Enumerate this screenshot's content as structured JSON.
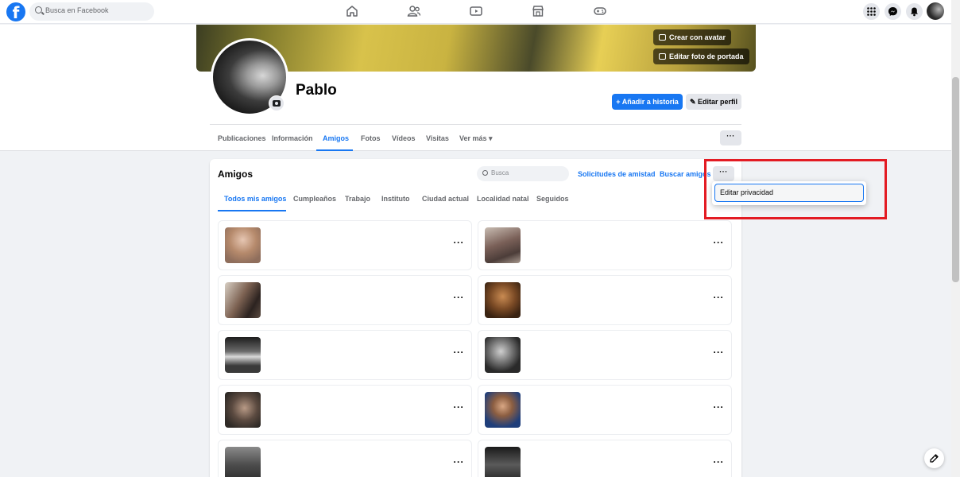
{
  "topbar": {
    "logo": "f",
    "search_placeholder": "Busca en Facebook",
    "nav_icons": [
      "home-icon",
      "friends-icon",
      "watch-icon",
      "marketplace-icon",
      "gaming-icon"
    ],
    "right_icons": [
      "menu-grid-icon",
      "messenger-icon",
      "bell-icon",
      "account-avatar"
    ]
  },
  "profile": {
    "name": "Pablo",
    "cover_buttons": {
      "avatar": "Crear con avatar",
      "cover": "Editar foto de portada"
    },
    "add_story": "Añadir a historia",
    "edit_profile": "Editar perfil",
    "tabs": [
      "Publicaciones",
      "Información",
      "Amigos",
      "Fotos",
      "Vídeos",
      "Visitas",
      "Ver más"
    ],
    "active_tab": "Amigos",
    "more_dots": "···"
  },
  "friends": {
    "title": "Amigos",
    "search_placeholder": "Busca",
    "requests_link": "Solicitudes de amistad",
    "find_link": "Buscar amigos",
    "more_dots": "···",
    "tabs": [
      "Todos mis amigos",
      "Cumpleaños",
      "Trabajo",
      "Instituto",
      "Ciudad actual",
      "Localidad natal",
      "Seguidos"
    ],
    "active_tab": "Todos mis amigos",
    "row_dots": "···"
  },
  "dropdown": {
    "item": "Editar privacidad"
  },
  "colors": {
    "accent": "#1877f2",
    "highlight": "#e31b23",
    "background": "#f0f2f5"
  }
}
